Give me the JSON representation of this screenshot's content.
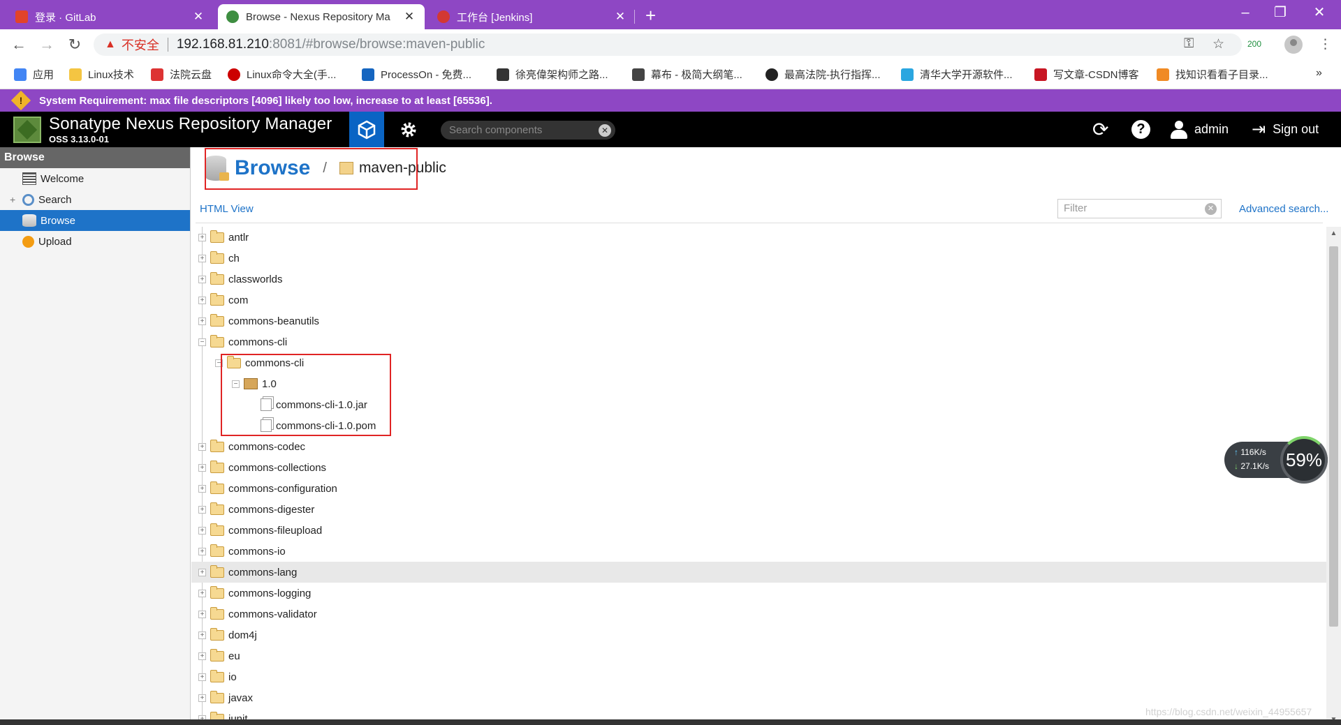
{
  "browser": {
    "tabs": [
      {
        "title": "登录 · GitLab",
        "favicon": "gitlab-icon",
        "color": "#e24329"
      },
      {
        "title": "Browse - Nexus Repository Ma",
        "favicon": "nexus-icon",
        "color": "#3e8e41"
      },
      {
        "title": "工作台 [Jenkins]",
        "favicon": "jenkins-icon",
        "color": "#d33833"
      }
    ],
    "security_label": "不安全",
    "url_host": "192.168.81.210",
    "url_rest": ":8081/#browse/browse:maven-public",
    "status_badge": "200",
    "bookmarks": [
      {
        "label": "应用",
        "icon": "apps-grid-icon",
        "color": "#4285f4"
      },
      {
        "label": "Linux技术",
        "icon": "folder-icon",
        "color": "#f4c542"
      },
      {
        "label": "法院云盘",
        "icon": "cloud-icon",
        "color": "#d33"
      },
      {
        "label": "Linux命令大全(手...",
        "icon": "redhat-icon",
        "color": "#cc0000"
      },
      {
        "label": "ProcessOn - 免费...",
        "icon": "processon-icon",
        "color": "#1565c0"
      },
      {
        "label": "徐亮偉架构师之路...",
        "icon": "blog-icon",
        "color": "#333333"
      },
      {
        "label": "幕布 - 极简大纲笔...",
        "icon": "mubu-icon",
        "color": "#444444"
      },
      {
        "label": "最高法院-执行指挥...",
        "icon": "court-icon",
        "color": "#222222"
      },
      {
        "label": "清华大学开源软件...",
        "icon": "tuna-icon",
        "color": "#2aa6e0"
      },
      {
        "label": "写文章-CSDN博客",
        "icon": "csdn-icon",
        "color": "#c81623"
      },
      {
        "label": "找知识看看子目录...",
        "icon": "zhihu-icon",
        "color": "#f08a24"
      }
    ]
  },
  "banner": {
    "text": "System Requirement: max file descriptors [4096] likely too low, increase to at least [65536]."
  },
  "header": {
    "product": "Sonatype Nexus Repository Manager",
    "version": "OSS 3.13.0-01",
    "search_placeholder": "Search components",
    "user": "admin",
    "sign_out": "Sign out"
  },
  "sidebar": {
    "heading": "Browse",
    "items": [
      {
        "label": "Welcome",
        "icon": "welcome-icon"
      },
      {
        "label": "Search",
        "icon": "search-icon"
      },
      {
        "label": "Browse",
        "icon": "browse-icon"
      },
      {
        "label": "Upload",
        "icon": "upload-icon"
      }
    ]
  },
  "content": {
    "title": "Browse",
    "separator": "/",
    "repository": "maven-public",
    "html_view": "HTML View",
    "filter_placeholder": "Filter",
    "advanced_search": "Advanced search..."
  },
  "tree": [
    {
      "label": "antlr",
      "type": "folder",
      "depth": 0,
      "state": "collapsed"
    },
    {
      "label": "ch",
      "type": "folder",
      "depth": 0,
      "state": "collapsed"
    },
    {
      "label": "classworlds",
      "type": "folder",
      "depth": 0,
      "state": "collapsed"
    },
    {
      "label": "com",
      "type": "folder",
      "depth": 0,
      "state": "collapsed"
    },
    {
      "label": "commons-beanutils",
      "type": "folder",
      "depth": 0,
      "state": "collapsed"
    },
    {
      "label": "commons-cli",
      "type": "folder",
      "depth": 0,
      "state": "expanded"
    },
    {
      "label": "commons-cli",
      "type": "folder",
      "depth": 1,
      "state": "expanded"
    },
    {
      "label": "1.0",
      "type": "package",
      "depth": 2,
      "state": "expanded"
    },
    {
      "label": "commons-cli-1.0.jar",
      "type": "file",
      "depth": 3,
      "state": "leaf"
    },
    {
      "label": "commons-cli-1.0.pom",
      "type": "file",
      "depth": 3,
      "state": "leaf"
    },
    {
      "label": "commons-codec",
      "type": "folder",
      "depth": 0,
      "state": "collapsed"
    },
    {
      "label": "commons-collections",
      "type": "folder",
      "depth": 0,
      "state": "collapsed"
    },
    {
      "label": "commons-configuration",
      "type": "folder",
      "depth": 0,
      "state": "collapsed"
    },
    {
      "label": "commons-digester",
      "type": "folder",
      "depth": 0,
      "state": "collapsed"
    },
    {
      "label": "commons-fileupload",
      "type": "folder",
      "depth": 0,
      "state": "collapsed"
    },
    {
      "label": "commons-io",
      "type": "folder",
      "depth": 0,
      "state": "collapsed"
    },
    {
      "label": "commons-lang",
      "type": "folder",
      "depth": 0,
      "state": "collapsed",
      "highlighted": true
    },
    {
      "label": "commons-logging",
      "type": "folder",
      "depth": 0,
      "state": "collapsed"
    },
    {
      "label": "commons-validator",
      "type": "folder",
      "depth": 0,
      "state": "collapsed"
    },
    {
      "label": "dom4j",
      "type": "folder",
      "depth": 0,
      "state": "collapsed"
    },
    {
      "label": "eu",
      "type": "folder",
      "depth": 0,
      "state": "collapsed"
    },
    {
      "label": "io",
      "type": "folder",
      "depth": 0,
      "state": "collapsed"
    },
    {
      "label": "javax",
      "type": "folder",
      "depth": 0,
      "state": "collapsed"
    },
    {
      "label": "junit",
      "type": "folder",
      "depth": 0,
      "state": "collapsed"
    }
  ],
  "net_widget": {
    "upload": "116K/s",
    "download": "27.1K/s",
    "percent": "59%"
  },
  "watermark": "https://blog.csdn.net/weixin_44955657",
  "colors": {
    "accent": "#1e73c8",
    "tabstrip": "#8e47c4",
    "annotation_red": "#e02424"
  }
}
